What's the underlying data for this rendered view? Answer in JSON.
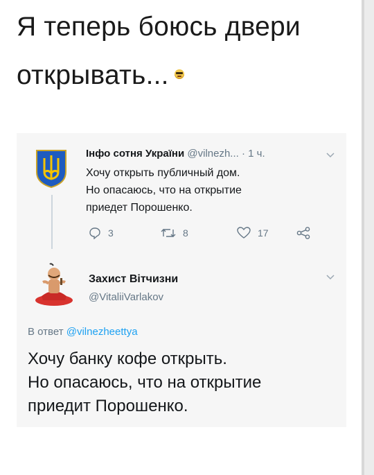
{
  "post": {
    "line1": "Я теперь боюсь двери",
    "line2": "открывать...",
    "emoji_icon": "face-emoji"
  },
  "tweet1": {
    "display_name": "Інфо сотня України",
    "handle": "@vilnezh...",
    "time": "· 1 ч.",
    "lines": [
      "Хочу открыть публичный дом.",
      "Но опасаюсь, что на открытие",
      "приедет Порошенко."
    ],
    "reply_count": "3",
    "retweet_count": "8",
    "like_count": "17"
  },
  "tweet2": {
    "display_name": "Захист Вітчизни",
    "handle": "@VitaliiVarlakov",
    "reply_prefix": "В ответ",
    "reply_handle": "@vilnezheettya",
    "lines": [
      "Хочу банку кофе открыть.",
      "Но опасаюсь, что на открытие",
      "приедит Порошенко."
    ]
  },
  "colors": {
    "link": "#1da1f2",
    "muted": "#657786",
    "card_bg": "#f6f6f6"
  }
}
